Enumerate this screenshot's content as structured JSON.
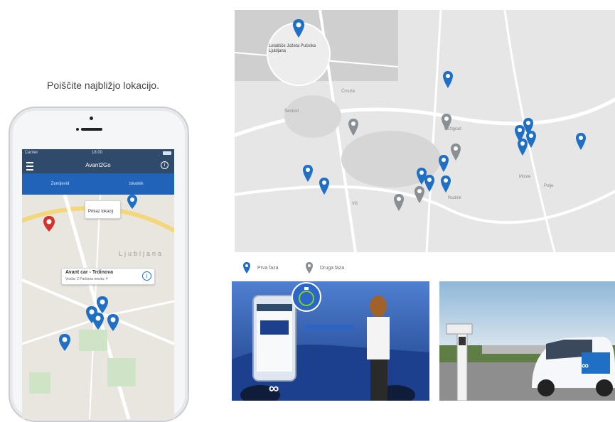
{
  "caption": "Poiščite najbližjo lokacijo.",
  "phone": {
    "statusbar": {
      "carrier": "Carrier",
      "time": "18:00"
    },
    "appbar": {
      "title": "Avant2Go"
    },
    "tabs": [
      {
        "label": "Zemljevid"
      },
      {
        "label": "Iskalnik"
      }
    ],
    "map": {
      "callout_top": "Prikaz lokacij",
      "district_label": "Ljubljana",
      "callout": {
        "title": "Avant car - Trdinova",
        "sub": "Vozila: 2 Parkirna mesta: 4"
      }
    }
  },
  "bigmap": {
    "magnifier_label": "Letališče Jožeta Pučnika Ljubljana",
    "places": [
      "Črnuče",
      "Šentvid",
      "Bežigrad",
      "Vič",
      "Moste",
      "Rudnik",
      "Polje"
    ],
    "legend": [
      {
        "label": "Prva faza",
        "color": "#1f6fc5"
      },
      {
        "label": "Druga faza",
        "color": "#8a8f94"
      }
    ]
  },
  "photo1": {
    "brand_mark": "∞"
  },
  "photo2": {
    "brand_mark": "∞"
  },
  "colors": {
    "primary_blue": "#1f6fc5",
    "appbar": "#2f4a6a",
    "tabs": "#1f64b8",
    "pin_red": "#d0342c",
    "pin_gray": "#8a8f94"
  }
}
